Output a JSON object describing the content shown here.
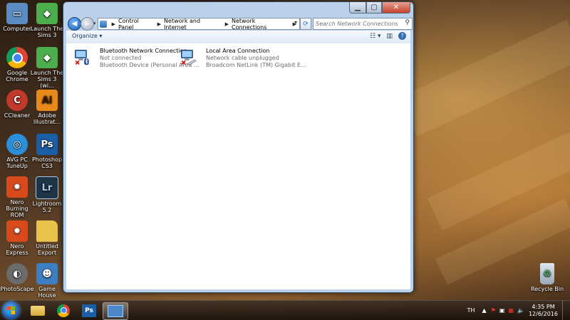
{
  "desktop": {
    "icons": [
      {
        "label": "Computer",
        "icon": "computer-icon",
        "color": "#5a8cc2"
      },
      {
        "label": "Launch The Sims 3",
        "icon": "sims-icon",
        "color": "#4cae4c"
      },
      {
        "label": "Google Chrome",
        "icon": "chrome-icon",
        "color": "#db4437"
      },
      {
        "label": "Launch The Sims 3 (wi...",
        "icon": "sims-icon",
        "color": "#4cae4c"
      },
      {
        "label": "CCleaner",
        "icon": "ccleaner-icon",
        "color": "#c0392b"
      },
      {
        "label": "Adobe Illustrat...",
        "icon": "illustrator-icon",
        "color": "#e88a1a"
      },
      {
        "label": "AVG PC TuneUp",
        "icon": "avg-icon",
        "color": "#2a8fd8"
      },
      {
        "label": "Photoshop CS3",
        "icon": "photoshop-icon",
        "color": "#1b5ea8"
      },
      {
        "label": "Nero Burning ROM",
        "icon": "nero-icon",
        "color": "#d84a1b"
      },
      {
        "label": "Lightroom 5.2",
        "icon": "lightroom-icon",
        "color": "#1e3447"
      },
      {
        "label": "Nero Express",
        "icon": "nero-express-icon",
        "color": "#d84a1b"
      },
      {
        "label": "Untitled Export",
        "icon": "folder-icon",
        "color": "#e8c24a"
      },
      {
        "label": "PhotoScape",
        "icon": "photoscape-icon",
        "color": "#6b6b6b"
      },
      {
        "label": "Game House",
        "icon": "gamehouse-icon",
        "color": "#3d7fc2"
      }
    ],
    "recycle_bin": "Recycle Bin"
  },
  "window": {
    "breadcrumb": [
      "Control Panel",
      "Network and Internet",
      "Network Connections"
    ],
    "search_placeholder": "Search Network Connections",
    "organize_label": "Organize",
    "connections": [
      {
        "name": "Bluetooth Network Connection",
        "status": "Not connected",
        "device": "Bluetooth Device (Personal Area ..."
      },
      {
        "name": "Local Area Connection",
        "status": "Network cable unplugged",
        "device": "Broadcom NetLink (TM) Gigabit E..."
      }
    ]
  },
  "taskbar": {
    "apps": [
      "explorer-icon",
      "chrome-icon",
      "photoshop-icon",
      "network-connections-icon"
    ],
    "language": "TH",
    "time": "4:35 PM",
    "date": "12/6/2016"
  }
}
